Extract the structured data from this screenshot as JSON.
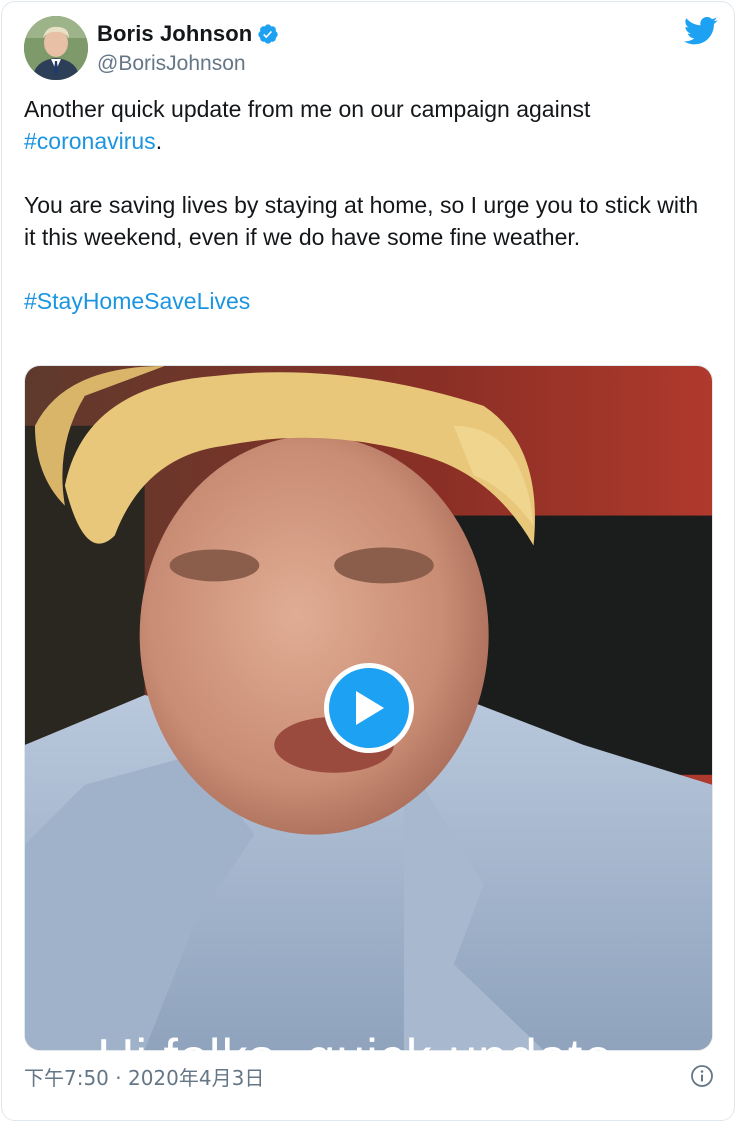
{
  "author": {
    "display_name": "Boris Johnson",
    "handle": "@BorisJohnson",
    "verified_icon": "verified-badge-icon",
    "avatar_icon": "avatar"
  },
  "brand": {
    "icon": "twitter-bird-icon",
    "color": "#1da1f2"
  },
  "tweet": {
    "line1_text": "Another quick update from me on our campaign against",
    "line1_hashtag": "#coronavirus",
    "line1_suffix": ".",
    "paragraph2": "You are saving lives by staying at home, so I urge you to stick with it this weekend, even if we do have some fine weather.",
    "hashtag2": "#StayHomeSaveLives"
  },
  "media": {
    "type": "video",
    "caption": "Hi folks, quick update",
    "play_icon": "play-icon"
  },
  "footer": {
    "timestamp": "下午7:50 · 2020年4月3日",
    "info_icon": "info-icon"
  },
  "colors": {
    "hashtag": "#1b95e0",
    "text": "#14171a",
    "secondary": "#657786"
  }
}
